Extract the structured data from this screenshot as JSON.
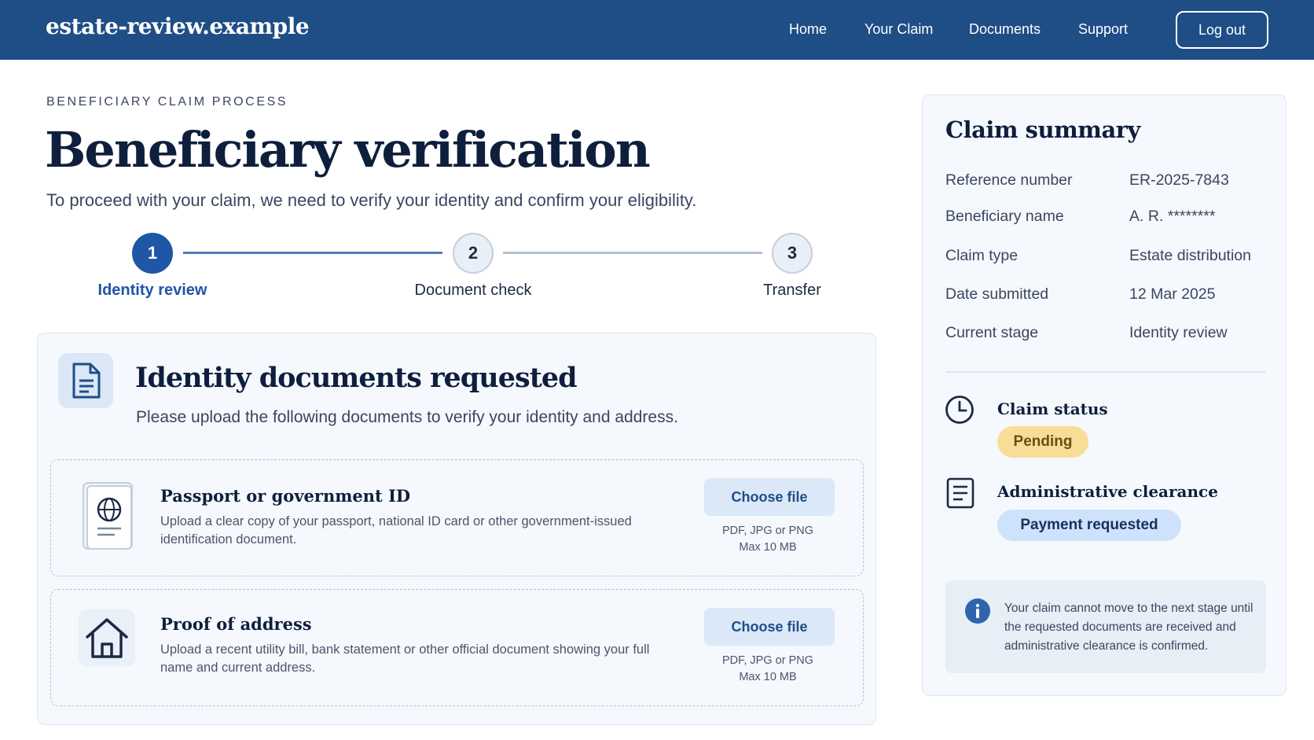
{
  "header": {
    "brand": "estate-review.example",
    "nav": [
      "Home",
      "Your Claim",
      "Documents",
      "Support"
    ],
    "logout_label": "Log out"
  },
  "page": {
    "overline": "BENEFICIARY CLAIM PROCESS",
    "title": "Beneficiary verification",
    "subtitle": "To proceed with your claim, we need to verify your identity and confirm your eligibility."
  },
  "stepper": {
    "active_step": 1,
    "steps": [
      {
        "number": "1",
        "label": "Identity review"
      },
      {
        "number": "2",
        "label": "Document check"
      },
      {
        "number": "3",
        "label": "Transfer"
      }
    ]
  },
  "upload": {
    "title": "Identity documents requested",
    "subtitle": "Please upload the following documents to verify your identity and address.",
    "documents": [
      {
        "name": "Passport or government ID",
        "description": "Upload a clear copy of your passport, national ID card or other government-issued identification document.",
        "button": "Choose file",
        "formats": "PDF, JPG or PNG",
        "max_size": "Max 10 MB",
        "icon": "passport-icon"
      },
      {
        "name": "Proof of address",
        "description": "Upload a recent utility bill, bank statement or other official document showing your full name and current address.",
        "button": "Choose file",
        "formats": "PDF, JPG or PNG",
        "max_size": "Max 10 MB",
        "icon": "house-icon"
      }
    ]
  },
  "summary": {
    "title": "Claim summary",
    "rows": [
      {
        "label": "Reference number",
        "value": "ER-2025-7843"
      },
      {
        "label": "Beneficiary name",
        "value": "A. R. ********"
      },
      {
        "label": "Claim type",
        "value": "Estate distribution"
      },
      {
        "label": "Date submitted",
        "value": "12 Mar 2025"
      },
      {
        "label": "Current stage",
        "value": "Identity review"
      }
    ],
    "claim_status_label": "Claim status",
    "claim_status_value": "Pending",
    "clearance_label": "Administrative clearance",
    "clearance_value": "Payment requested",
    "info": "Your claim cannot move to the next stage until the requested documents are received and administrative clearance is confirmed."
  },
  "colors": {
    "header_bg": "#1f4e86",
    "accent": "#1f4e86",
    "pending_badge": "#f7dd97",
    "clearance_badge": "#cfe2fb"
  }
}
